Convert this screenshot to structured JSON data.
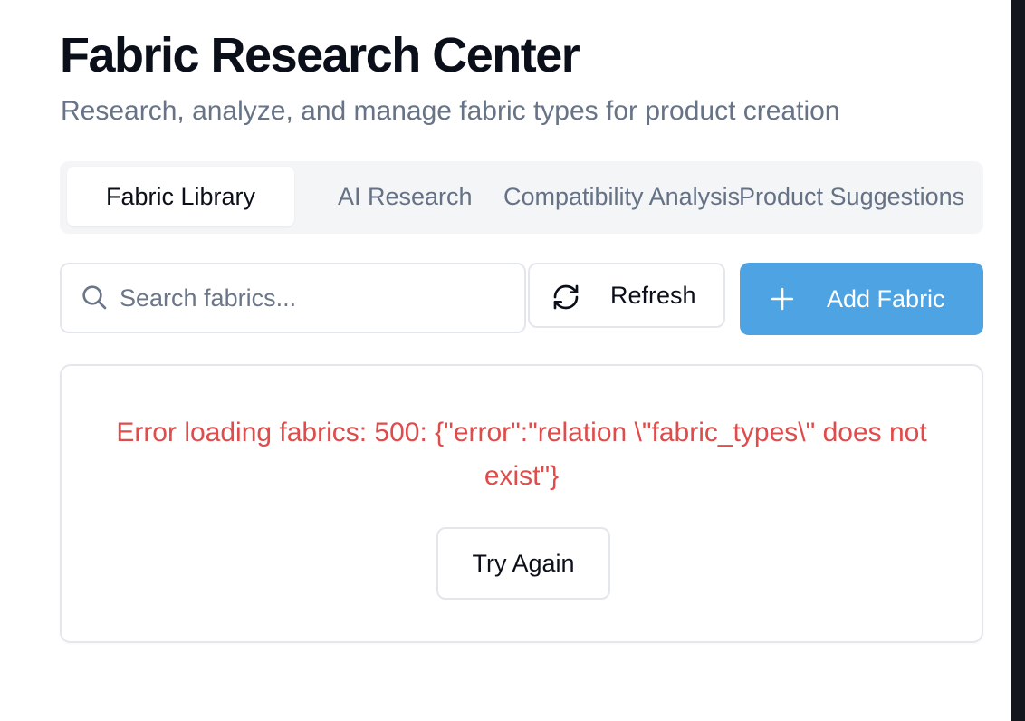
{
  "header": {
    "title": "Fabric Research Center",
    "subtitle": "Research, analyze, and manage fabric types for product creation"
  },
  "tabs": [
    {
      "label": "Fabric Library",
      "active": true
    },
    {
      "label": "AI Research",
      "active": false
    },
    {
      "label": "Compatibility Analysis",
      "active": false
    },
    {
      "label": "Product Suggestions",
      "active": false
    }
  ],
  "toolbar": {
    "search_placeholder": "Search fabrics...",
    "search_value": "",
    "refresh_label": "Refresh",
    "add_label": "Add Fabric",
    "icons": {
      "search": "search-icon",
      "refresh": "refresh-icon",
      "add": "plus-icon"
    }
  },
  "error": {
    "message": "Error loading fabrics: 500: {\"error\":\"relation \\\"fabric_types\\\" does not exist\"}",
    "retry_label": "Try Again"
  },
  "colors": {
    "accent": "#4ea3e3",
    "error": "#de4c4c",
    "muted_text": "#677488",
    "tab_bar": "#f3f5f7"
  }
}
